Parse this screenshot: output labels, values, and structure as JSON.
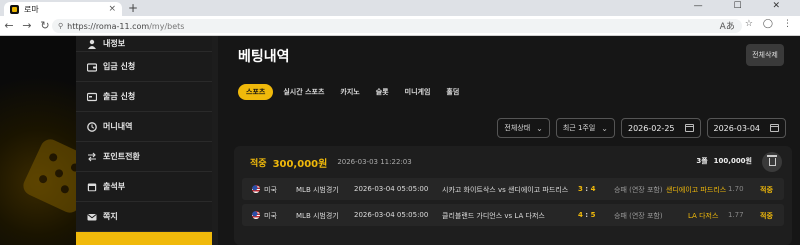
{
  "browser": {
    "tab_title": "로마",
    "tab_close": "×",
    "new_tab": "+",
    "url_host": "https://roma-11.com",
    "url_path": "/my/bets",
    "nav_back": "←",
    "nav_forward": "→",
    "nav_reload": "↻",
    "window_controls": "— ☐ ✕"
  },
  "sidebar": {
    "items": [
      {
        "label": "내정보",
        "icon": "user-icon"
      },
      {
        "label": "입금 신청",
        "icon": "deposit-icon"
      },
      {
        "label": "출금 신청",
        "icon": "withdraw-icon"
      },
      {
        "label": "머니내역",
        "icon": "clock-icon"
      },
      {
        "label": "포인트전환",
        "icon": "exchange-icon"
      },
      {
        "label": "출석부",
        "icon": "calendar-icon"
      },
      {
        "label": "쪽지",
        "icon": "mail-icon"
      }
    ]
  },
  "main": {
    "title": "베팅내역",
    "delete_all": "전체삭제",
    "tabs": [
      "스포츠",
      "실시간 스포츠",
      "카지노",
      "슬롯",
      "미니게임",
      "홀덤"
    ],
    "active_tab": 0,
    "filters": {
      "status": "전체상태",
      "period": "최근 1주일",
      "date_from": "2026-02-25",
      "date_to": "2026-03-04",
      "chevron": "⌄"
    }
  },
  "bet": {
    "result_label": "적중",
    "amount": "300,000원",
    "bet_time": "2026-03-03 11:22:03",
    "fold_count": "3폴",
    "stake": "100,000원",
    "rows": [
      {
        "country": "미국",
        "league": "MLB 시범경기",
        "start_time": "2026-03-04 05:05:00",
        "match": "시카고 화이트삭스 vs 샌디에이고 파드리스",
        "score_home": "3",
        "score_away": "4",
        "bet_type": "승패 (연장 포함)",
        "pick": "샌디에이고 파드리스",
        "odds": "1.70",
        "result": "적중"
      },
      {
        "country": "미국",
        "league": "MLB 시범경기",
        "start_time": "2026-03-04 05:05:00",
        "match": "클리블랜드 가디언스 vs LA 다저스",
        "score_home": "4",
        "score_away": "5",
        "bet_type": "승패 (연장 포함)",
        "pick": "LA 다저스",
        "odds": "1.77",
        "result": "적중"
      }
    ]
  },
  "colors": {
    "accent": "#f0b90b",
    "background": "#141414",
    "card": "#1e1e1e"
  }
}
